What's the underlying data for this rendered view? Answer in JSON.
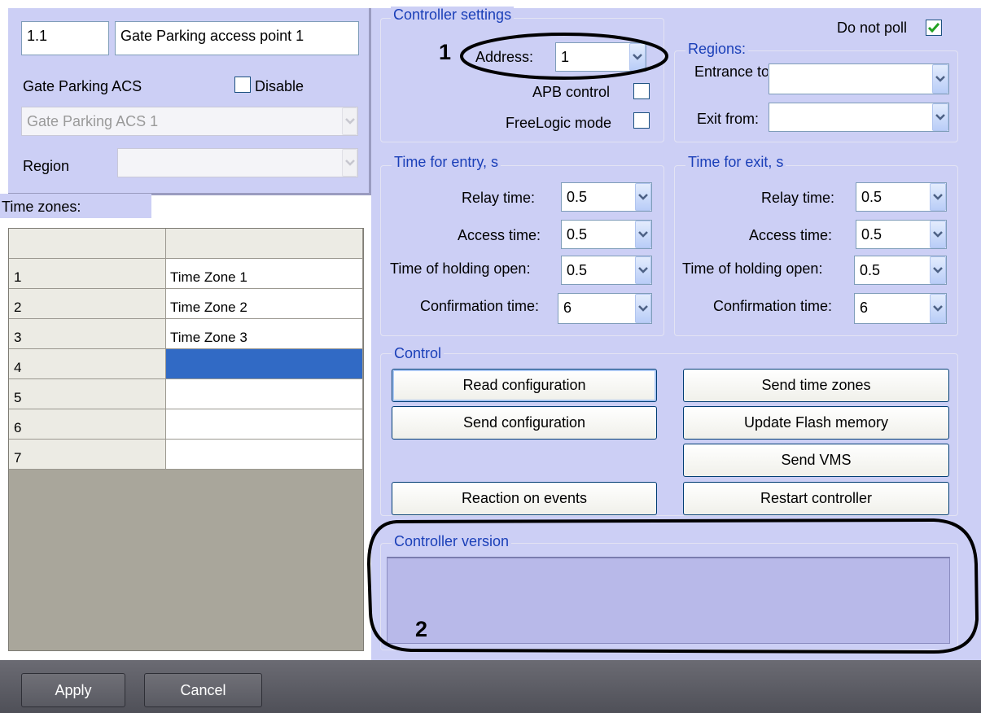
{
  "access_point": {
    "id": "1.1",
    "name": "Gate Parking access point 1",
    "parent_type": "Gate Parking ACS",
    "disable_label": "Disable",
    "parent_value": "Gate Parking ACS 1",
    "region_label": "Region",
    "region_value": ""
  },
  "time_zones": {
    "label": "Time zones:",
    "rows": [
      {
        "num": "1",
        "name": "Time Zone 1"
      },
      {
        "num": "2",
        "name": "Time Zone 2"
      },
      {
        "num": "3",
        "name": "Time Zone 3"
      },
      {
        "num": "4",
        "name": ""
      },
      {
        "num": "5",
        "name": ""
      },
      {
        "num": "6",
        "name": ""
      },
      {
        "num": "7",
        "name": ""
      }
    ]
  },
  "controller_settings": {
    "title": "Controller settings",
    "annotation_1": "1",
    "address_label": "Address:",
    "address_value": "1",
    "apb_label": "APB control",
    "freelogic_label": "FreeLogic mode",
    "do_not_poll_label": "Do not poll"
  },
  "regions": {
    "title": "Regions:",
    "entrance_label": "Entrance to:",
    "exit_label": "Exit from:",
    "entrance_value": "",
    "exit_value": ""
  },
  "time_entry": {
    "title": "Time for entry, s",
    "relay_label": "Relay time:",
    "relay_value": "0.5",
    "access_label": "Access time:",
    "access_value": "0.5",
    "holding_label": "Time of holding open:",
    "holding_value": "0.5",
    "confirm_label": "Confirmation time:",
    "confirm_value": "6"
  },
  "time_exit": {
    "title": "Time for exit, s",
    "relay_label": "Relay time:",
    "relay_value": "0.5",
    "access_label": "Access time:",
    "access_value": "0.5",
    "holding_label": "Time of holding open:",
    "holding_value": "0.5",
    "confirm_label": "Confirmation time:",
    "confirm_value": "6"
  },
  "control": {
    "title": "Control",
    "read_config": "Read configuration",
    "send_config": "Send configuration",
    "reaction_events": "Reaction on events",
    "send_time_zones": "Send time zones",
    "update_flash": "Update Flash memory",
    "send_vms": "Send VMS",
    "restart": "Restart controller"
  },
  "controller_version": {
    "title": "Controller version",
    "annotation_2": "2",
    "value": ""
  },
  "footer": {
    "apply": "Apply",
    "cancel": "Cancel"
  },
  "colors": {
    "panel": "#cccff5",
    "group_title": "#1a3fb8",
    "selection": "#316ac5",
    "annotation_ellipse": "#000000"
  }
}
